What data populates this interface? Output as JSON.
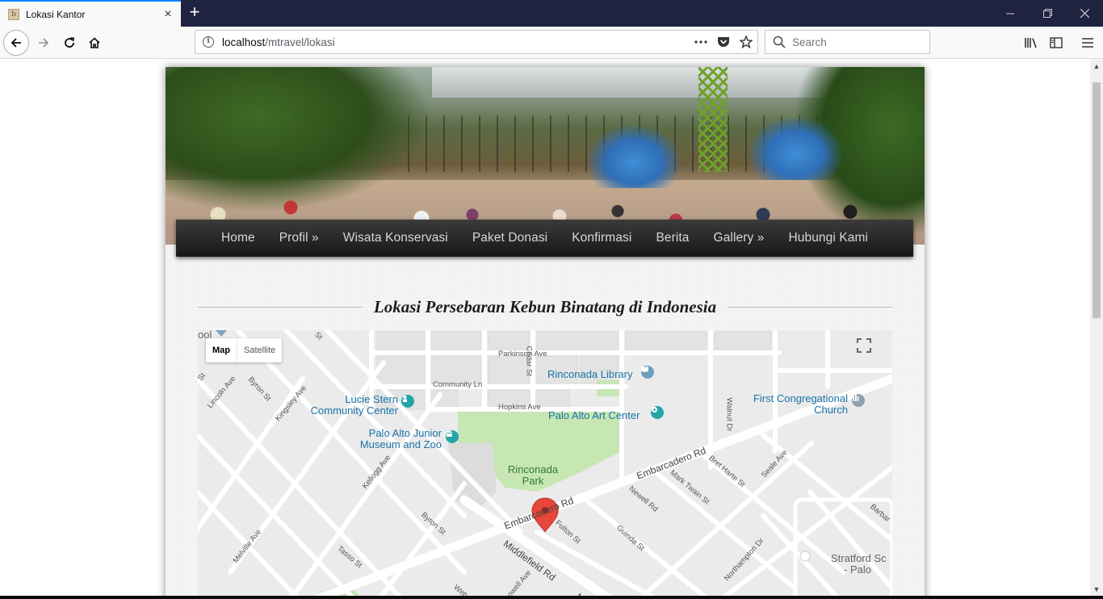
{
  "browser": {
    "tab_title": "Lokasi Kantor",
    "favicon_letter": "b",
    "url_host": "localhost",
    "url_path": "/mtravel/lokasi",
    "search_placeholder": "Search"
  },
  "site": {
    "menu": [
      {
        "label": "Home"
      },
      {
        "label": "Profil »"
      },
      {
        "label": "Wisata Konservasi"
      },
      {
        "label": "Paket Donasi"
      },
      {
        "label": "Konfirmasi"
      },
      {
        "label": "Berita"
      },
      {
        "label": "Gallery »"
      },
      {
        "label": "Hubungi Kami"
      }
    ],
    "page_heading": "Lokasi Persebaran Kebun Binatang di Indonesia"
  },
  "map": {
    "type_buttons": {
      "map": "Map",
      "satellite": "Satellite"
    },
    "places": {
      "rinconada_library": "Rinconada Library",
      "lucie_stern_1": "Lucie Stern",
      "lucie_stern_2": "Community Center",
      "palo_alto_art_center": "Palo Alto Art Center",
      "first_cong_1": "First Congregational",
      "first_cong_2": "Church",
      "palo_alto_zoo_1": "Palo Alto Junior",
      "palo_alto_zoo_2": "Museum and Zoo",
      "rinconada_park_1": "Rinconada",
      "rinconada_park_2": "Park",
      "stratford_1": "Stratford Sc",
      "stratford_2": "- Palo",
      "pool": "ool"
    },
    "streets": {
      "parkinson": "Parkinson Ave",
      "cedar": "Cedar St",
      "community_ln": "Community Ln",
      "hopkins": "Hopkins Ave",
      "walnut": "Walnut Dr",
      "lincoln": "Lincoln Ave",
      "byron_top": "Byron St",
      "kingsley": "Kingsley Ave",
      "embarcadero_right": "Embarcadero Rd",
      "embarcadero_mid": "Embarcadero Rd",
      "mark_twain": "Mark Twain St",
      "bret_harte": "Bret Harte St",
      "seale": "Seale Ave",
      "newell": "Newell Rd",
      "kellogg": "Kellogg Ave",
      "byron_bottom": "Byron St",
      "fulton": "Fulton St",
      "guinda": "Guinda St",
      "middlefield": "Middlefield Rd",
      "melville": "Melville Ave",
      "tasso": "Tasso St",
      "northampton": "Northampton Dr",
      "barbara": "Barbar",
      "webster": "Webst",
      "lowell": "Lowell Ave",
      "st_left": "St",
      "st_top": "St",
      "mi": "Mi"
    }
  }
}
